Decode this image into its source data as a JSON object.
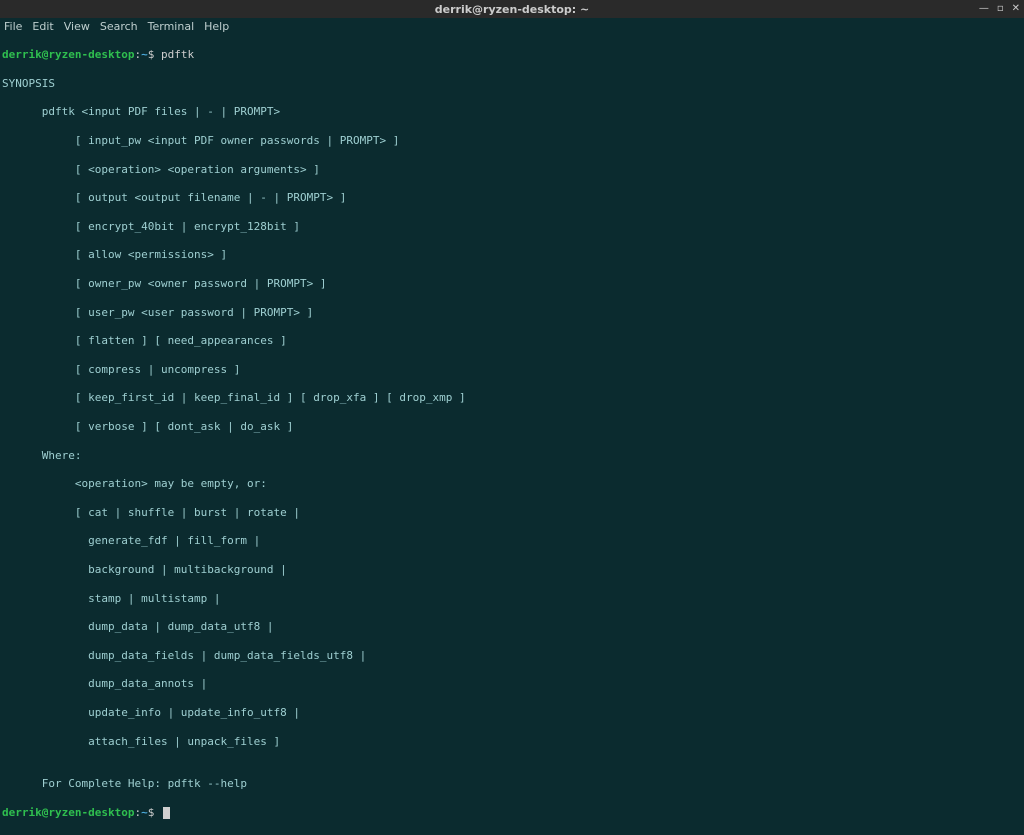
{
  "window": {
    "title": "derrik@ryzen-desktop: ~"
  },
  "menubar": {
    "items": [
      "File",
      "Edit",
      "View",
      "Search",
      "Terminal",
      "Help"
    ]
  },
  "window_controls": {
    "minimize": "—",
    "maximize": "▫",
    "close": "✕"
  },
  "prompt": {
    "user_host": "derrik@ryzen-desktop",
    "colon": ":",
    "path": "~",
    "dollar": "$"
  },
  "commands": {
    "cmd1": "pdftk"
  },
  "output": {
    "l0": "SYNOPSIS",
    "l1": "      pdftk <input PDF files | - | PROMPT>",
    "l2": "           [ input_pw <input PDF owner passwords | PROMPT> ]",
    "l3": "           [ <operation> <operation arguments> ]",
    "l4": "           [ output <output filename | - | PROMPT> ]",
    "l5": "           [ encrypt_40bit | encrypt_128bit ]",
    "l6": "           [ allow <permissions> ]",
    "l7": "           [ owner_pw <owner password | PROMPT> ]",
    "l8": "           [ user_pw <user password | PROMPT> ]",
    "l9": "           [ flatten ] [ need_appearances ]",
    "l10": "           [ compress | uncompress ]",
    "l11": "           [ keep_first_id | keep_final_id ] [ drop_xfa ] [ drop_xmp ]",
    "l12": "           [ verbose ] [ dont_ask | do_ask ]",
    "l13": "      Where:",
    "l14": "           <operation> may be empty, or:",
    "l15": "           [ cat | shuffle | burst | rotate |",
    "l16": "             generate_fdf | fill_form |",
    "l17": "             background | multibackground |",
    "l18": "             stamp | multistamp |",
    "l19": "             dump_data | dump_data_utf8 |",
    "l20": "             dump_data_fields | dump_data_fields_utf8 |",
    "l21": "             dump_data_annots |",
    "l22": "             update_info | update_info_utf8 |",
    "l23": "             attach_files | unpack_files ]",
    "l24": "",
    "l25": "      For Complete Help: pdftk --help"
  }
}
